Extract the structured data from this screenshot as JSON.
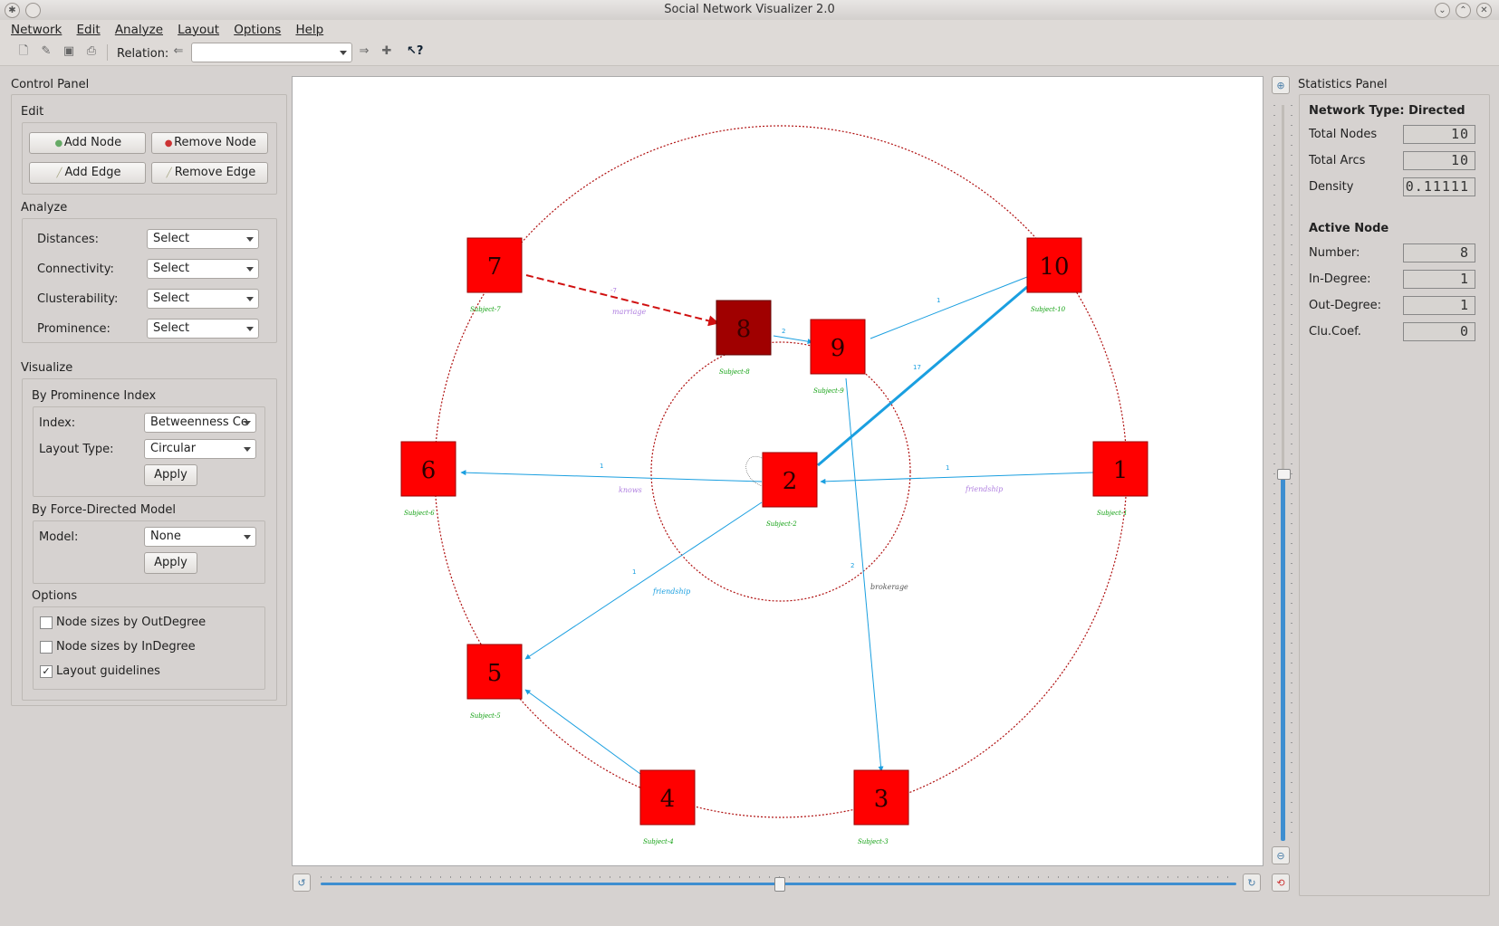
{
  "window": {
    "title": "Social Network Visualizer 2.0"
  },
  "menu": [
    "Network",
    "Edit",
    "Analyze",
    "Layout",
    "Options",
    "Help"
  ],
  "toolbar": {
    "relation_label": "Relation:",
    "relation_value": ""
  },
  "control_panel": {
    "title": "Control Panel",
    "edit": {
      "title": "Edit",
      "add_node": "Add Node",
      "remove_node": "Remove Node",
      "add_edge": "Add Edge",
      "remove_edge": "Remove Edge"
    },
    "analyze": {
      "title": "Analyze",
      "rows": [
        {
          "label": "Distances:",
          "value": "Select"
        },
        {
          "label": "Connectivity:",
          "value": "Select"
        },
        {
          "label": "Clusterability:",
          "value": "Select"
        },
        {
          "label": "Prominence:",
          "value": "Select"
        }
      ]
    },
    "visualize": {
      "title": "Visualize",
      "prominence": {
        "title": "By Prominence Index",
        "index_label": "Index:",
        "index_value": "Betweenness Ce",
        "layout_label": "Layout Type:",
        "layout_value": "Circular",
        "apply": "Apply"
      },
      "force": {
        "title": "By Force-Directed Model",
        "model_label": "Model:",
        "model_value": "None",
        "apply": "Apply"
      },
      "options": {
        "title": "Options",
        "items": [
          {
            "label": "Node sizes by OutDegree",
            "checked": false
          },
          {
            "label": "Node sizes by InDegree",
            "checked": false
          },
          {
            "label": "Layout guidelines",
            "checked": true
          }
        ]
      }
    }
  },
  "graph": {
    "node_color": "#ff0000",
    "active_node_color": "#a00000",
    "edge_color": "#1a9fe0",
    "guide_color": "#b01010",
    "label_color": "#10a010",
    "nodes": [
      {
        "id": "1",
        "label": "Subject-1"
      },
      {
        "id": "2",
        "label": "Subject-2"
      },
      {
        "id": "3",
        "label": "Subject-3"
      },
      {
        "id": "4",
        "label": "Subject-4"
      },
      {
        "id": "5",
        "label": "Subject-5"
      },
      {
        "id": "6",
        "label": "Subject-6"
      },
      {
        "id": "7",
        "label": "Subject-7"
      },
      {
        "id": "8",
        "label": "Subject-8"
      },
      {
        "id": "9",
        "label": "Subject-9"
      },
      {
        "id": "10",
        "label": "Subject-10"
      }
    ],
    "edge_labels": {
      "marriage": "marriage",
      "knows": "knows",
      "friendship_1": "friendship",
      "friendship_2": "friendship",
      "brokerage": "brokerage",
      "w7": "-7",
      "w89": "2",
      "w109": "1",
      "w102": "17",
      "w26": "1",
      "w12": "1",
      "w25": "1",
      "w93": "2"
    }
  },
  "stats": {
    "title": "Statistics Panel",
    "network_type": "Network Type: Directed",
    "total_nodes_label": "Total Nodes",
    "total_nodes": "10",
    "total_arcs_label": "Total Arcs",
    "total_arcs": "10",
    "density_label": "Density",
    "density": "0.11111",
    "active_title": "Active Node",
    "number_label": "Number:",
    "number": "8",
    "indegree_label": "In-Degree:",
    "indegree": "1",
    "outdegree_label": "Out-Degree:",
    "outdegree": "1",
    "clucoef_label": "Clu.Coef.",
    "clucoef": "0"
  },
  "zoom_level": 0.5,
  "rotation_level": 0.5
}
